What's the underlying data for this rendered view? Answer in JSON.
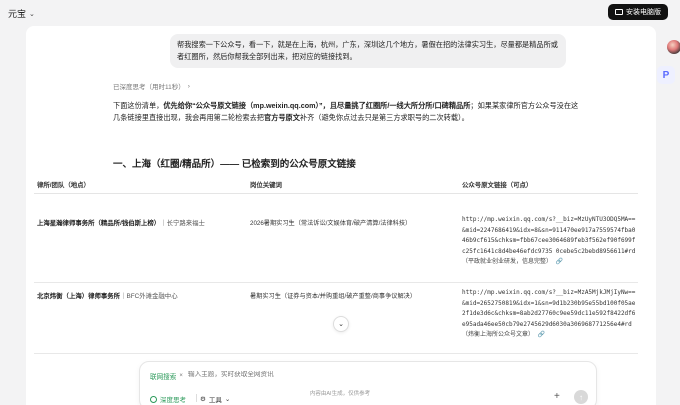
{
  "app": {
    "title": "元宝",
    "install_label": "安装电脑版"
  },
  "chat": {
    "user_message": "帮我搜索一下公众号，看一下，就是在上海，杭州，广东，深圳这几个地方，暑假在招的法律实习生，尽量都是精品所或者红圈所，然后你帮我全部列出来，把对应的链接找到。",
    "thought_status": "已深度思考（用时11秒）",
    "answer": {
      "p1": "下面这份清单，",
      "p2": "优先给你“公众号原文链接（mp.weixin.qq.com）”，且尽量挑了红圈所/一线大所分所/口碑精品所",
      "p3": "；如果某家律所官方公众号没在这几条链接里直接出现，我会再用第二轮检索去把",
      "p4": "官方号原文",
      "p5": "补齐（避免你点过去只是第三方求职号的二次转载）。"
    },
    "section_title": "一、上海（红圈/精品所）—— 已检索到的公众号原文链接"
  },
  "table": {
    "headers": [
      "律所/团队（地点）",
      "岗位关键词",
      "公众号原文链接（可点）"
    ],
    "rows": [
      {
        "firm": "上海星瀚律师事务所（精品所/钱伯斯上榜）",
        "location": "｜长宁路来福士",
        "role": "2026暑期实习生（常法诉讼/文娱体育/破产清算/法律科技）",
        "link": "http://mp.weixin.qq.com/s?__biz=MzUyNTU3ODQ5MA==&mid=2247686419&idx=8&sn=911470ee917a7559574fba046b9cf615&chksm=fbb67cee3064689feb3f562ef90f699fc25fc1641c8d4be46efdc9735 0cebe5c2bebd8956611#rd",
        "note": "（平政就业创业研发，信息完整）"
      },
      {
        "firm": "北京炜衡（上海）律师事务所",
        "location": "｜BFC外滩金融中心",
        "role": "暑期实习生（证券与资本/并购重组/破产重整/商事争议解决）",
        "link": "http://mp.weixin.qq.com/s?__biz=MzA5MjkJMjIyNw==&mid=2652750819&idx=1&sn=9d1b230b95e55bd100f05ae2f1de3d6c&chksm=8ab2d27760c9ee59dc11e592f8422df6e95ada46ee50cb79e2745629d6030a306968771256e4#rd",
        "note": "（炜衡上海所公众号文章）"
      }
    ]
  },
  "composer": {
    "mode_tag": "联网搜索",
    "placeholder": "输入主题，实时获取全网资讯",
    "deep_think": "深度思考",
    "tools": "工具"
  },
  "footer": {
    "disclaimer": "内容由AI生成，仅供参考"
  },
  "colors": {
    "accent_green": "#2b9a5a",
    "dark_button": "#111111"
  }
}
